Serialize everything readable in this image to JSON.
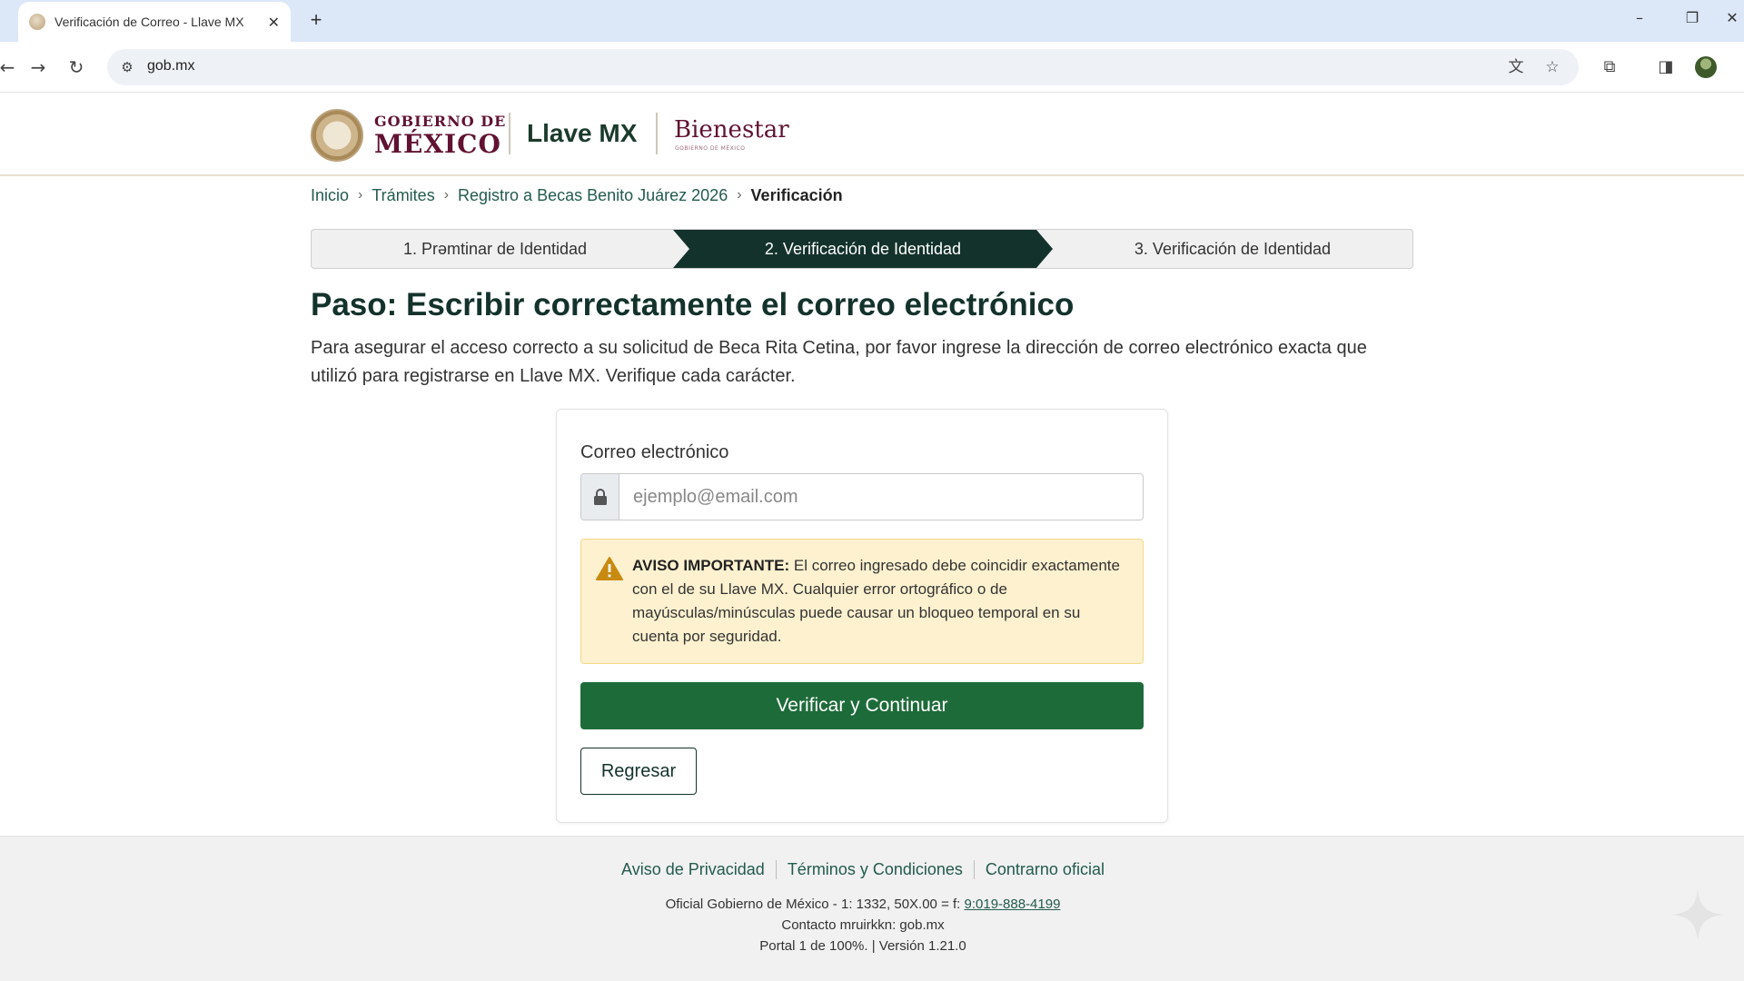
{
  "browser": {
    "tab_title": "Verificación de Correo - Llave MX",
    "tab_close": "✕",
    "new_tab": "+",
    "url": "gob.mx",
    "window_controls": {
      "minimize": "–",
      "restore": "❐",
      "close": "✕"
    }
  },
  "header": {
    "gob_line1": "GOBIERNO DE",
    "gob_line2": "MÉXICO",
    "llave": "Llave MX",
    "bienestar": "Bienestar",
    "bienestar_sub": "GOBIERNO DE MÉXICO"
  },
  "breadcrumb": {
    "items": [
      "Inicio",
      "Trámites",
      "Registro a Becas Benito Juárez 2026"
    ],
    "current": "Verificación"
  },
  "stepper": {
    "steps": [
      "1. Prəmtinar de Identidad",
      "2. Verificación de Identidad",
      "3. Verificación de Identidad"
    ],
    "active_index": 1
  },
  "main": {
    "title": "Paso: Escribir correctamente el correo electrónico",
    "description": "Para asegurar el acceso correcto a su solicitud de Beca Rita Cetina, por favor ingrese la dirección de correo electrónico exacta que utilizó para registrarse en Llave MX. Verifique cada carácter."
  },
  "form": {
    "email_label": "Correo electrónico",
    "email_placeholder": "ejemplo@email.com",
    "email_value": "",
    "alert_strong": "AVISO IMPORTANTE:",
    "alert_text": " El correo ingresado debe coincidir exactamente con el de su Llave MX. Cualquier error ortográfico o de mayúsculas/minúsculas puede causar un bloqueo temporal en su cuenta por seguridad.",
    "submit_label": "Verificar y Continuar",
    "back_label": "Regresar"
  },
  "footer": {
    "links": [
      "Aviso de Privacidad",
      "Términos y Condiciones",
      "Contrarno oficial"
    ],
    "line1_text": "Oficial Gobierno de México - 1: 1332, 50X.00 = f: ",
    "line1_phone": "9:019-888-4199",
    "line2": "Contacto mruirkkn: gob.mx",
    "line3": "Portal 1 de 100%. | Versión 1.21.0"
  },
  "colors": {
    "primary_green": "#1e6b3a",
    "dark_green": "#13322b",
    "link_green": "#235b4e",
    "guinda": "#611232",
    "alert_bg": "#fdf1cf"
  },
  "icons": {
    "back": "arrow-left-icon",
    "forward": "arrow-right-icon",
    "reload": "reload-icon",
    "site_settings": "tune-icon",
    "translate": "translate-icon",
    "bookmark": "star-icon",
    "extensions": "puzzle-icon",
    "sidepanel": "side-panel-icon",
    "lock": "lock-icon",
    "warning": "warning-icon"
  }
}
